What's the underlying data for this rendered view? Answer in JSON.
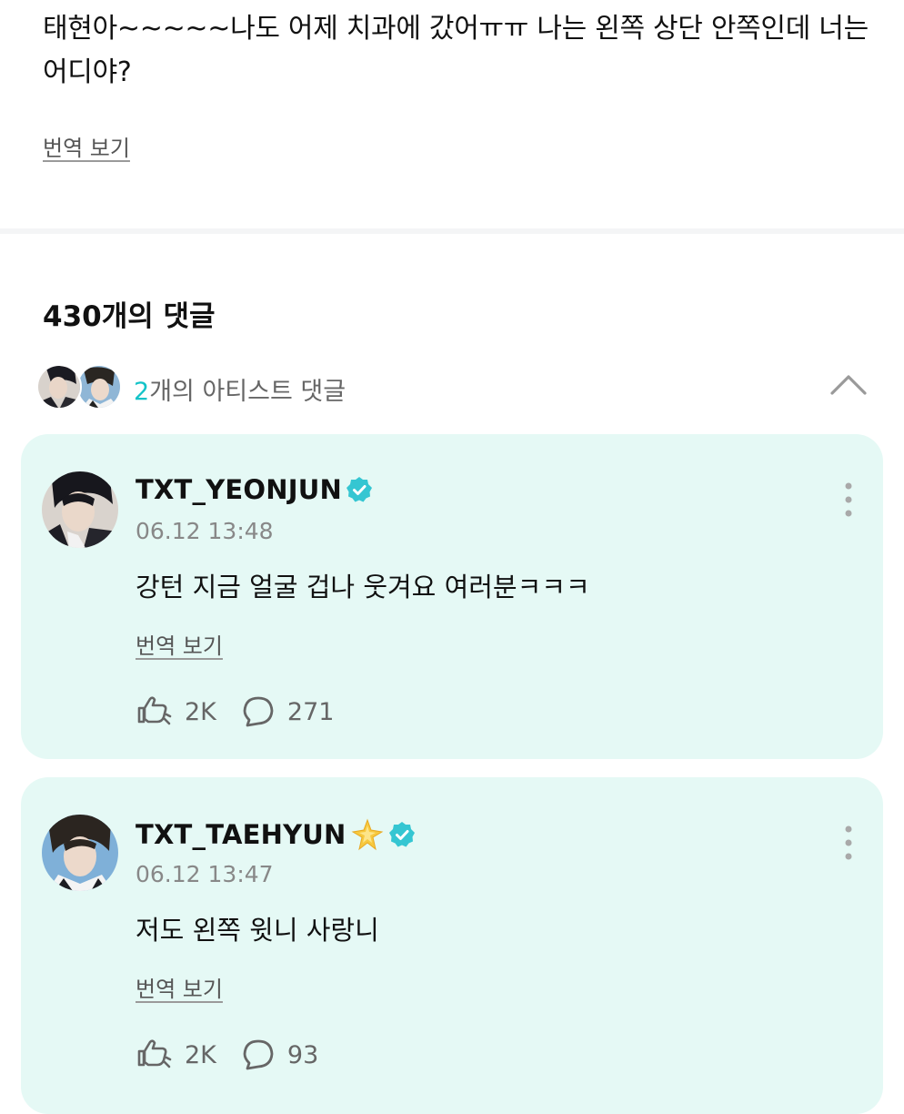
{
  "post": {
    "text": "태현아~~~~~나도 어제 치과에 갔어ㅠㅠ 나는 왼쪽 상단 안쪽인데 너는 어디야?",
    "translate_label": "번역 보기"
  },
  "comments_header": {
    "count_label": "430개의 댓글"
  },
  "artist_comments": {
    "count": "2",
    "label_suffix": "개의 아티스트 댓글"
  },
  "comments": [
    {
      "username": "TXT_YEONJUN",
      "timestamp": "06.12 13:48",
      "text": "강턴 지금 얼굴 겁나 웃겨요 여러분ㅋㅋㅋ",
      "translate_label": "번역 보기",
      "likes": "2K",
      "replies": "271"
    },
    {
      "username": "TXT_TAEHYUN",
      "timestamp": "06.12 13:47",
      "text": "저도 왼쪽 윗니 사랑니",
      "translate_label": "번역 보기",
      "likes": "2K",
      "replies": "93"
    }
  ],
  "colors": {
    "accent": "#13c3c8",
    "card_bg": "#e5f9f5",
    "verified": "#35c6d2"
  },
  "icons": [
    "verified-icon",
    "sparkle-icon",
    "more-icon",
    "like-icon",
    "comment-icon",
    "chevron-up-icon"
  ]
}
